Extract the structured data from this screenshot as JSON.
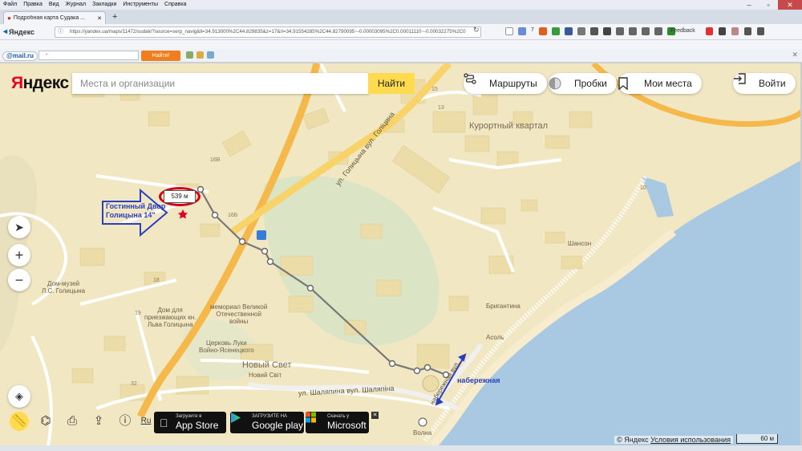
{
  "browser": {
    "menu": [
      "Файл",
      "Правка",
      "Вид",
      "Журнал",
      "Закладки",
      "Инструменты",
      "Справка"
    ],
    "tab_title": "Подробная карта Судака ...",
    "brand": "Яндекс",
    "url": "https://yandex.ua/maps/11472/sudak/?source=serp_navig&ll=34.913000%2C44.829835&z=17&rl=34.91554285%2C44.82790095~-0.00003095%2C0.00011110~-0.00032275%2C0",
    "badge_count": "7",
    "feedback_label": "Feedback",
    "colors": {
      "close": "#c7494b",
      "tabbar": "#d6dce6"
    }
  },
  "mailbar": {
    "logo": "@mail.ru",
    "select_value": "-",
    "button_label": "Найти!"
  },
  "header": {
    "logo_first": "Я",
    "logo_rest": "ндекс",
    "search_placeholder": "Места и организации",
    "search_button": "Найти",
    "routes": "Маршруты",
    "traffic": "Пробки",
    "my_places": "Мои места",
    "login": "Войти"
  },
  "map": {
    "district": "Курортный квартал",
    "places": {
      "museum": "Дом-музей\nЛ.С. Голицына",
      "guest_house": "Дом для\nприезжающих кн.\nЛьва Голицына",
      "memorial": "мемориал Великой\nОтечественной\nвойны",
      "church": "Церковь Луки\nВойно-Ясенецкого",
      "novy_svet": "Новый Свет",
      "novy_svit": "Новий Світ",
      "shanson": "Шансон",
      "brigantina": "Бригантина",
      "asol": "Асоль",
      "volna": "Волна"
    },
    "streets": {
      "golitsyna": "ул. Голицына вул. Голіцина",
      "shalyapina": "ул. Шаляпина вул. Шаляпіна",
      "naberezhnaya": "набережная вул."
    },
    "house_numbers": [
      "16В",
      "16Б",
      "18",
      "19",
      "32",
      "15",
      "13",
      "10"
    ],
    "distance_label": "539 м",
    "annotation_hotel": "Гостинный Двор\nГолицына 14\"",
    "annotation_embankment": "набережная",
    "zoom_in": "+",
    "zoom_out": "−",
    "road_color": "#f5b84a",
    "sea_color": "#a9c8e2"
  },
  "footer": {
    "lang": "Ru",
    "appstore_small": "Загрузите в",
    "appstore_big": "App Store",
    "gplay_small": "ЗАГРУЗИТЕ НА",
    "gplay_big": "Google play",
    "ms_small": "Скачать у",
    "ms_big": "Microsoft",
    "close": "✕",
    "copyright": "© Яндекс",
    "terms": "Условия использования",
    "scale": "60 м"
  }
}
